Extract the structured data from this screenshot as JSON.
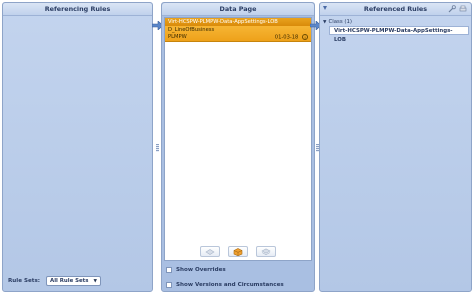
{
  "left_panel": {
    "title": "Referencing Rules",
    "ruleset_label": "Rule Sets:",
    "ruleset_value": "All Rule Sets"
  },
  "middle_panel": {
    "title": "Data Page",
    "item": {
      "name": "Virt-HCSPW-PLMPW-Data-AppSettings-LOB",
      "key": "D_LineOfBusiness",
      "ruleset": "PLMPW",
      "version": "01-03-18",
      "info": "i"
    },
    "show_overrides": "Show Overrides",
    "show_versions": "Show Versions and Circumstances"
  },
  "right_panel": {
    "title": "Referenced Rules",
    "group_label": "Class (1)",
    "leaf": "Virt-HCSPW-PLMPW-Data-AppSettings-LOB"
  },
  "colors": {
    "panel_bg": "#b3c7e6",
    "selection_orange": "#eea11a",
    "arrow_blue": "#5b86c9"
  }
}
